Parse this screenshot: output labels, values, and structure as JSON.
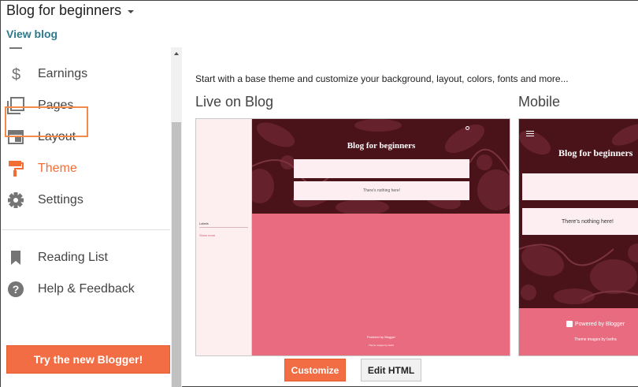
{
  "header": {
    "blog_title": "Blog for beginners",
    "view_blog": "View blog"
  },
  "sidebar": {
    "items": [
      {
        "label": "Earnings",
        "icon": "dollar-icon"
      },
      {
        "label": "Pages",
        "icon": "pages-icon"
      },
      {
        "label": "Layout",
        "icon": "layout-icon"
      },
      {
        "label": "Theme",
        "icon": "paint-roller-icon",
        "active": true
      },
      {
        "label": "Settings",
        "icon": "gear-icon"
      },
      {
        "label": "Reading List",
        "icon": "bookmark-icon"
      },
      {
        "label": "Help & Feedback",
        "icon": "help-icon"
      }
    ],
    "cta": "Try the new Blogger!"
  },
  "main": {
    "intro": "Start with a base theme and customize your background, layout, colors, fonts and more...",
    "live_title": "Live on Blog",
    "mobile_title": "Mobile",
    "preview": {
      "blog_title": "Blog for beginners",
      "empty_msg": "There's nothing here!",
      "labels": "Labels",
      "show_more": "Show more",
      "powered": "Powered by Blogger",
      "theme_images": "Theme images by",
      "theme_author": "Ixefra"
    },
    "customize": "Customize",
    "edit_html": "Edit HTML"
  },
  "colors": {
    "accent": "#f26d43",
    "link": "#2c7a8b",
    "hero": "#4a1219",
    "pink": "#e86b80"
  }
}
